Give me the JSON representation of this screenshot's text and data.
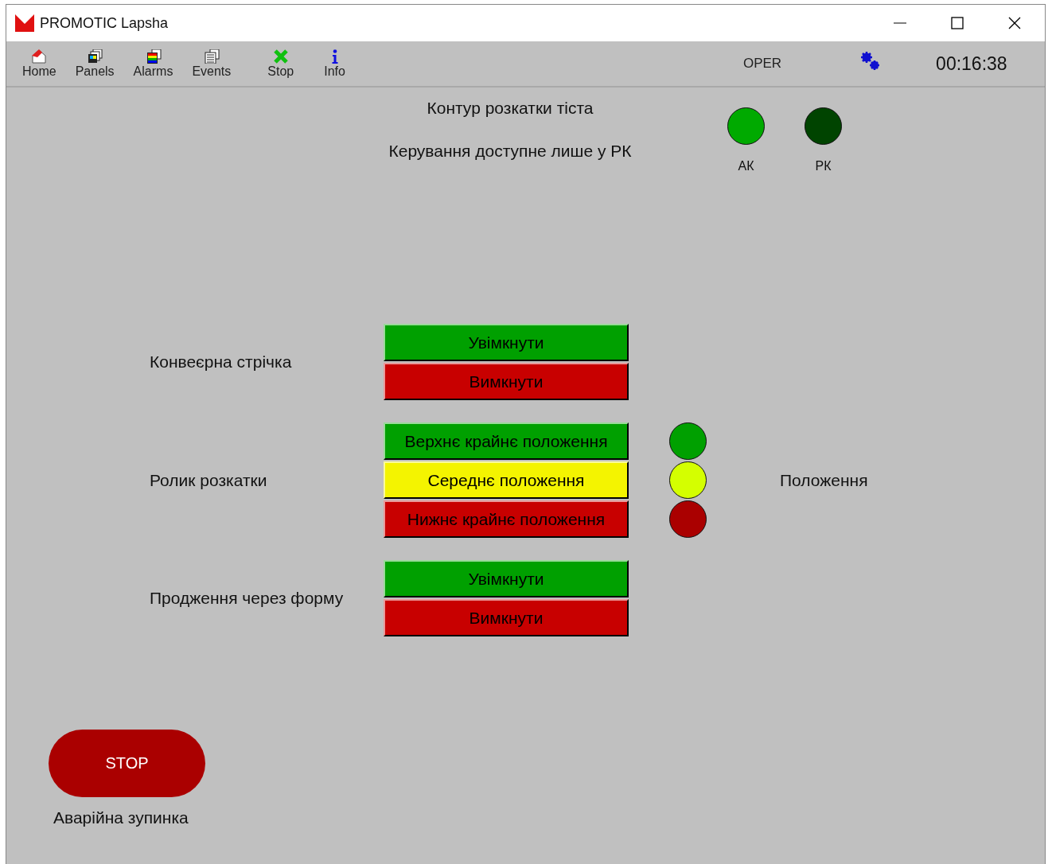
{
  "window": {
    "title": "PROMOTIC Lapsha"
  },
  "toolbar": {
    "items": [
      {
        "label": "Home",
        "kind": "home"
      },
      {
        "label": "Panels",
        "kind": "panels"
      },
      {
        "label": "Alarms",
        "kind": "alarms"
      },
      {
        "label": "Events",
        "kind": "events"
      },
      {
        "label": "Stop",
        "kind": "stop"
      },
      {
        "label": "Info",
        "kind": "info"
      }
    ],
    "mode": "OPER",
    "clock": "00:16:38"
  },
  "panel": {
    "title": "Контур розкатки тіста",
    "subtitle": "Керування доступне лише у РК",
    "lamps": [
      {
        "label": "АК",
        "color": "#00aa00"
      },
      {
        "label": "РК",
        "color": "#004400"
      }
    ],
    "groups": [
      {
        "label": "Конвеєрна стрічка",
        "buttons": [
          {
            "label": "Увімкнути",
            "color": "#00a000"
          },
          {
            "label": "Вимкнути",
            "color": "#c80000"
          }
        ]
      },
      {
        "label": "Ролик розкатки",
        "buttons": [
          {
            "label": "Верхнє крайнє положення",
            "color": "#00a000"
          },
          {
            "label": "Середнє положення",
            "color": "#f4f400"
          },
          {
            "label": "Нижнє крайнє положення",
            "color": "#c80000"
          }
        ],
        "lamps": [
          {
            "color": "#00a000"
          },
          {
            "color": "#d4ff00"
          },
          {
            "color": "#aa0000"
          }
        ],
        "lamps_label": "Положення"
      },
      {
        "label": "Продження через форму",
        "buttons": [
          {
            "label": "Увімкнути",
            "color": "#00a000"
          },
          {
            "label": "Вимкнути",
            "color": "#c80000"
          }
        ]
      }
    ],
    "emergency": {
      "button": "STOP",
      "label": "Аварійна зупинка"
    }
  }
}
